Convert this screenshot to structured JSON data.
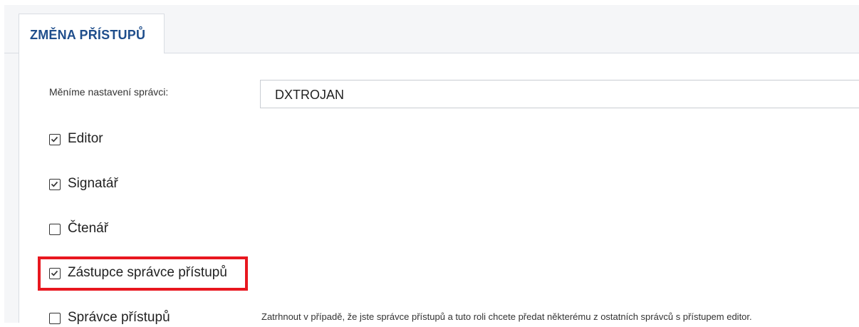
{
  "tab": {
    "label": "ZMĚNA PŘÍSTUPŮ"
  },
  "form": {
    "admin_label": "Měníme nastavení správci:",
    "admin_value": "DXTROJAN"
  },
  "roles": [
    {
      "label": "Editor",
      "checked": true
    },
    {
      "label": "Signatář",
      "checked": true
    },
    {
      "label": "Čtenář",
      "checked": false
    },
    {
      "label": "Zástupce správce přístupů",
      "checked": true,
      "highlighted": true
    },
    {
      "label": "Správce přístupů",
      "checked": false
    }
  ],
  "note": "Zatrhnout v případě, že jste správce přístupů a tuto roli chcete předat některému z ostatních správců s přístupem editor.",
  "colors": {
    "accent": "#1f4e8c",
    "highlight": "#e8171f"
  }
}
